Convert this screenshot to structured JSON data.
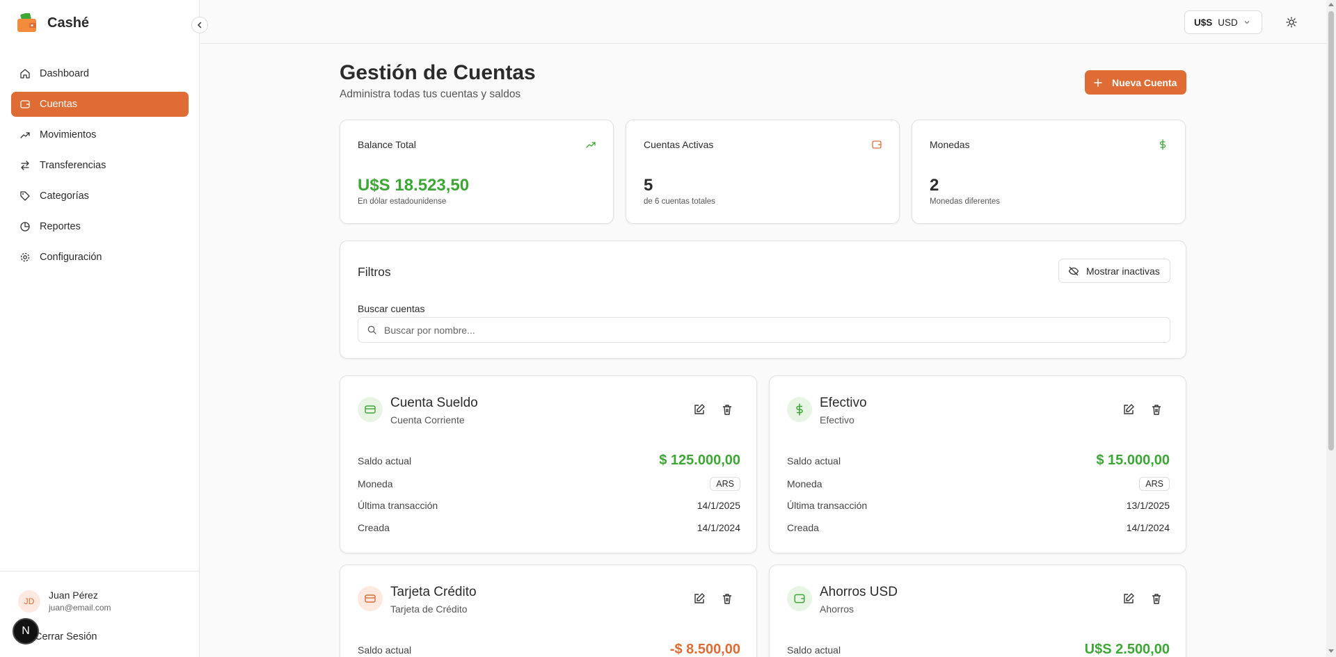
{
  "app": {
    "name": "Cashé"
  },
  "sidebar": {
    "items": [
      {
        "label": "Dashboard",
        "icon": "home-icon"
      },
      {
        "label": "Cuentas",
        "icon": "wallet-icon",
        "active": true
      },
      {
        "label": "Movimientos",
        "icon": "trending-up-icon"
      },
      {
        "label": "Transferencias",
        "icon": "arrows-left-right-icon"
      },
      {
        "label": "Categorías",
        "icon": "tag-icon"
      },
      {
        "label": "Reportes",
        "icon": "pie-chart-icon"
      },
      {
        "label": "Configuración",
        "icon": "gear-icon"
      }
    ],
    "user": {
      "initials": "JD",
      "name": "Juan Pérez",
      "email": "juan@email.com"
    },
    "logout_label": "Cerrar Sesión",
    "next_badge": "N"
  },
  "header": {
    "currency_symbol": "U$S",
    "currency_code": "USD"
  },
  "page": {
    "title": "Gestión de Cuentas",
    "subtitle": "Administra todas tus cuentas y saldos",
    "new_button": "Nueva Cuenta"
  },
  "stats": [
    {
      "label": "Balance Total",
      "value": "U$S 18.523,50",
      "desc": "En dólar estadounidense",
      "icon": "trending-up-icon"
    },
    {
      "label": "Cuentas Activas",
      "value": "5",
      "desc": "de 6 cuentas totales",
      "icon": "wallet-icon"
    },
    {
      "label": "Monedas",
      "value": "2",
      "desc": "Monedas diferentes",
      "icon": "dollar-icon"
    }
  ],
  "filters": {
    "title": "Filtros",
    "toggle_label": "Mostrar inactivas",
    "search_label": "Buscar cuentas",
    "search_placeholder": "Buscar por nombre..."
  },
  "labels": {
    "balance": "Saldo actual",
    "currency": "Moneda",
    "last_tx": "Última transacción",
    "created": "Creada"
  },
  "accounts": [
    {
      "name": "Cuenta Sueldo",
      "type": "Cuenta Corriente",
      "balance": "$ 125.000,00",
      "currency": "ARS",
      "last_tx": "14/1/2025",
      "created": "14/1/2024",
      "icon": "credit-card-icon"
    },
    {
      "name": "Efectivo",
      "type": "Efectivo",
      "balance": "$ 15.000,00",
      "currency": "ARS",
      "last_tx": "13/1/2025",
      "created": "14/1/2024",
      "icon": "dollar-icon"
    },
    {
      "name": "Tarjeta Crédito",
      "type": "Tarjeta de Crédito",
      "balance": "-$ 8.500,00",
      "icon": "credit-card-icon"
    },
    {
      "name": "Ahorros USD",
      "type": "Ahorros",
      "balance": "U$S 2.500,00",
      "icon": "wallet-icon"
    }
  ],
  "colors": {
    "accent": "#df6c35",
    "positive": "#3da736"
  }
}
